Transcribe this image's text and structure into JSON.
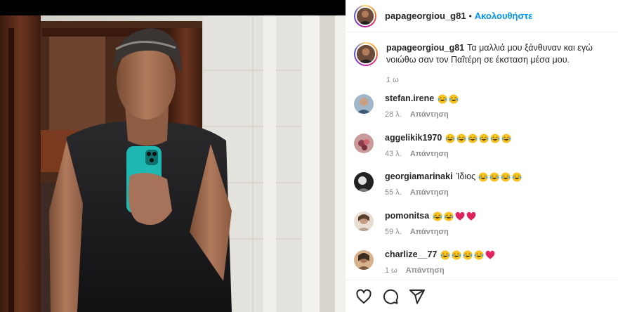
{
  "post": {
    "username": "papageorgiou_g81",
    "separator": "•",
    "follow_label": "Ακολουθήστε"
  },
  "caption": {
    "username": "papageorgiou_g81",
    "text": "Τα μαλλιά μου ξάνθυναν και εγώ νοιώθω σαν τον Παΐτέρη σε έκσταση μέσα μου.",
    "time": "1 ω"
  },
  "comments": [
    {
      "username": "stefan.irene",
      "text": "",
      "emoji": [
        "laugh-cry",
        "laugh-cry"
      ],
      "time": "28 λ.",
      "reply_label": "Απάντηση"
    },
    {
      "username": "aggelikik1970",
      "text": "",
      "emoji": [
        "laugh-cry",
        "laugh-cry",
        "laugh-cry",
        "laugh-cry",
        "laugh-cry",
        "laugh-cry"
      ],
      "time": "43 λ.",
      "reply_label": "Απάντηση"
    },
    {
      "username": "georgiamarinaki",
      "text": "Ίδιος",
      "emoji": [
        "laugh-cry",
        "laugh-cry",
        "laugh-cry",
        "laugh-cry"
      ],
      "time": "55 λ.",
      "reply_label": "Απάντηση"
    },
    {
      "username": "pomonitsa",
      "text": "",
      "emoji": [
        "laugh-cry",
        "laugh-cry",
        "red-heart",
        "red-heart"
      ],
      "time": "59 λ.",
      "reply_label": "Απάντηση"
    },
    {
      "username": "charlize__77",
      "text": "",
      "emoji": [
        "laugh-cry",
        "laugh-cry",
        "laugh-cry",
        "laugh-cry",
        "red-heart"
      ],
      "time": "1 ω",
      "reply_label": "Απάντηση"
    }
  ],
  "actions": {
    "icons": [
      "heart-icon",
      "comment-icon",
      "share-icon"
    ]
  },
  "colors": {
    "accent": "#0095f6",
    "text": "#262626",
    "muted": "#8e8e8e"
  }
}
